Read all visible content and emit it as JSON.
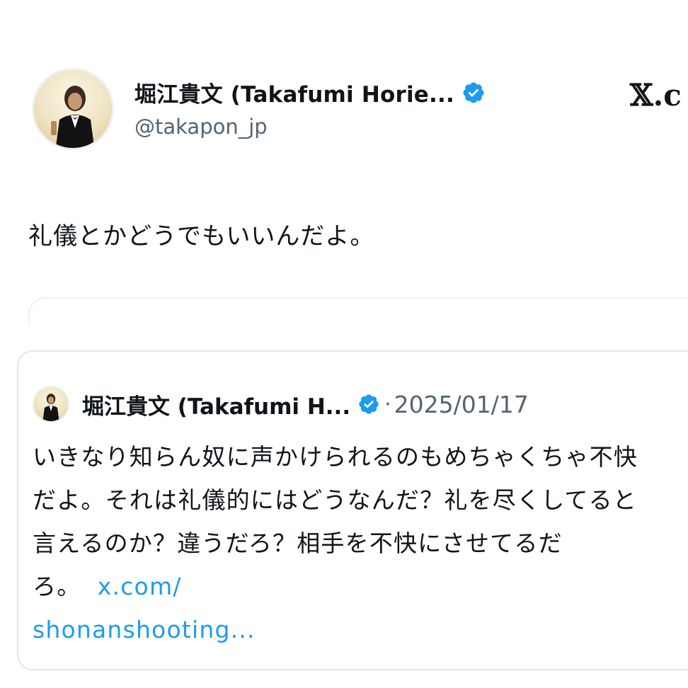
{
  "header": {
    "author_name": "堀江貴文 (Takafumi Horie...",
    "handle": "@takapon_jp",
    "x_logo": "𝕏.c"
  },
  "tweet": {
    "text": "礼儀とかどうでもいいんだよ。"
  },
  "quoted_tweet": {
    "author_name": "堀江貴文 (Takafumi H...",
    "separator": "·",
    "date": "2025/01/17",
    "body": "いきなり知らん奴に声かけられるのもめちゃくちゃ不快だよ。それは礼儀的にはどうなんだ？礼を尽くしてると言えるのか？違うだろ？相手を不快にさせてるだろ。",
    "link_part1": "x.com/",
    "link_part2": "shonanshooting..."
  },
  "colors": {
    "verified": "#1d9bf0",
    "link": "#1d9bf0",
    "secondary_text": "#536471",
    "primary_text": "#0f1419"
  },
  "icons": {
    "verified": "verified-badge-icon",
    "avatar": "profile-avatar",
    "logo": "x-logo-icon"
  }
}
